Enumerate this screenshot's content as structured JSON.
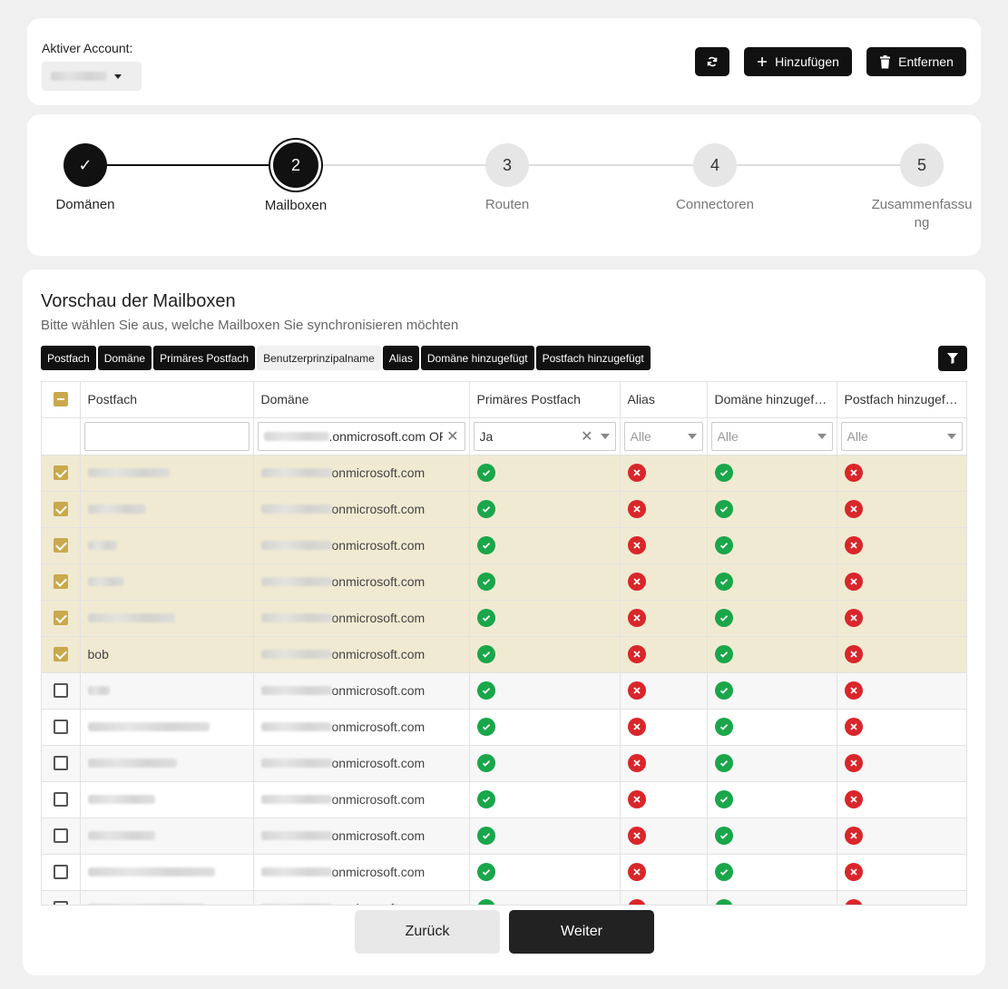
{
  "account": {
    "label": "Aktiver Account:",
    "refresh_icon": "refresh-icon",
    "add_label": "Hinzufügen",
    "add_icon": "plus-icon",
    "remove_label": "Entfernen",
    "remove_icon": "trash-icon"
  },
  "stepper": {
    "steps": [
      {
        "number": "✓",
        "label": "Domänen",
        "state": "done"
      },
      {
        "number": "2",
        "label": "Mailboxen",
        "state": "active"
      },
      {
        "number": "3",
        "label": "Routen",
        "state": "pending"
      },
      {
        "number": "4",
        "label": "Connectoren",
        "state": "pending"
      },
      {
        "number": "5",
        "label": "Zusammenfassung",
        "state": "pending"
      }
    ]
  },
  "preview": {
    "title": "Vorschau der Mailboxen",
    "subtitle": "Bitte wählen Sie aus, welche Mailboxen Sie synchronisieren möchten",
    "chips": [
      {
        "label": "Postfach",
        "active": true
      },
      {
        "label": "Domäne",
        "active": true
      },
      {
        "label": "Primäres Postfach",
        "active": true
      },
      {
        "label": "Benutzerprinzipalname",
        "active": false
      },
      {
        "label": "Alias",
        "active": true
      },
      {
        "label": "Domäne hinzugefügt",
        "active": true
      },
      {
        "label": "Postfach hinzugefügt",
        "active": true
      }
    ],
    "filter_icon": "filter-icon"
  },
  "table": {
    "headers": [
      "Postfach",
      "Domäne",
      "Primäres Postfach",
      "Alias",
      "Domäne hinzugefügt",
      "Postfach hinzugefügt"
    ],
    "filters": {
      "postfach": "",
      "domain": ".onmicrosoft.com OR",
      "primary": "Ja",
      "alias": "Alle",
      "domain_added": "Alle",
      "mailbox_added": "Alle"
    },
    "domain_suffix": "onmicrosoft.com",
    "rows": [
      {
        "name": "",
        "selected": true,
        "primary": true,
        "alias": false,
        "domain_added": true,
        "mailbox_added": false
      },
      {
        "name": "",
        "selected": true,
        "primary": true,
        "alias": false,
        "domain_added": true,
        "mailbox_added": false
      },
      {
        "name": "",
        "selected": true,
        "primary": true,
        "alias": false,
        "domain_added": true,
        "mailbox_added": false
      },
      {
        "name": "",
        "selected": true,
        "primary": true,
        "alias": false,
        "domain_added": true,
        "mailbox_added": false
      },
      {
        "name": "",
        "selected": true,
        "primary": true,
        "alias": false,
        "domain_added": true,
        "mailbox_added": false
      },
      {
        "name": "bob",
        "selected": true,
        "primary": true,
        "alias": false,
        "domain_added": true,
        "mailbox_added": false
      },
      {
        "name": "",
        "selected": false,
        "primary": true,
        "alias": false,
        "domain_added": true,
        "mailbox_added": false
      },
      {
        "name": "",
        "selected": false,
        "primary": true,
        "alias": false,
        "domain_added": true,
        "mailbox_added": false
      },
      {
        "name": "",
        "selected": false,
        "primary": true,
        "alias": false,
        "domain_added": true,
        "mailbox_added": false
      },
      {
        "name": "",
        "selected": false,
        "primary": true,
        "alias": false,
        "domain_added": true,
        "mailbox_added": false
      },
      {
        "name": "",
        "selected": false,
        "primary": true,
        "alias": false,
        "domain_added": true,
        "mailbox_added": false
      },
      {
        "name": "",
        "selected": false,
        "primary": true,
        "alias": false,
        "domain_added": true,
        "mailbox_added": false
      },
      {
        "name": "",
        "selected": false,
        "primary": true,
        "alias": false,
        "domain_added": true,
        "mailbox_added": false
      }
    ]
  },
  "nav": {
    "back_label": "Zurück",
    "next_label": "Weiter"
  }
}
